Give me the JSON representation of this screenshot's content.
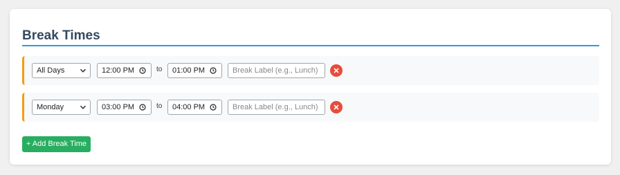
{
  "section": {
    "title": "Break Times"
  },
  "breaks": [
    {
      "day": "All Days",
      "start": "12:00 PM",
      "to": "to",
      "end": "01:00 PM",
      "label_placeholder": "Break Label (e.g., Lunch)"
    },
    {
      "day": "Monday",
      "start": "03:00 PM",
      "to": "to",
      "end": "04:00 PM",
      "label_placeholder": "Break Label (e.g., Lunch)"
    }
  ],
  "add_button": {
    "label": "+ Add Break Time"
  },
  "icons": {
    "select": "chevron-down-icon",
    "time": "clock-icon",
    "remove": "close-icon"
  },
  "colors": {
    "title": "#34495e",
    "title_rule": "#3498db",
    "row_accent": "#f39c12",
    "remove": "#e74c3c",
    "add": "#27ae60"
  }
}
